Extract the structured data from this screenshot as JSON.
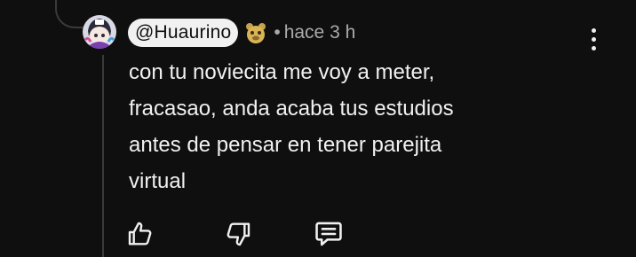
{
  "comment": {
    "author_handle": "@Huaurino",
    "separator": "•",
    "timestamp": "hace 3 h",
    "text": "con tu noviecita me voy a meter,\nfracasao, anda acaba tus estudios\nantes de pensar en tener parejita\nvirtual"
  },
  "icons": {
    "avatar": "anime-avatar",
    "badge": "member-badge-icon",
    "menu": "more-vert-icon",
    "like": "thumb-up-icon",
    "dislike": "thumb-down-icon",
    "reply": "comment-icon"
  },
  "colors": {
    "background": "#0f0f0f",
    "text": "#f1f1f1",
    "secondary_text": "#aaaaaa",
    "handle_chip": "#f1f1f1",
    "thread_line": "#3a3a3a"
  }
}
